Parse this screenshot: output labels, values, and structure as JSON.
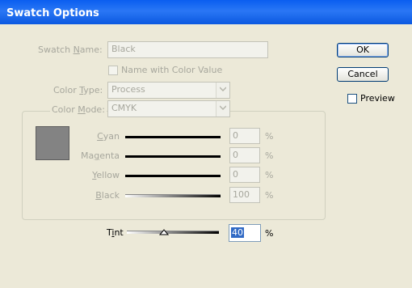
{
  "window": {
    "title": "Swatch Options"
  },
  "swatch_name": {
    "label_pre": "Swatch ",
    "label_u": "N",
    "label_post": "ame:",
    "value": "Black"
  },
  "name_with_color_value": {
    "label": "Name with Color Value",
    "checked": false
  },
  "color_type": {
    "label_pre": "Color ",
    "label_u": "T",
    "label_post": "ype:",
    "value": "Process"
  },
  "color_mode": {
    "label_pre": "Color ",
    "label_u": "M",
    "label_post": "ode:",
    "value": "CMYK"
  },
  "sliders": [
    {
      "pre": "",
      "u": "C",
      "post": "yan",
      "value": "0",
      "unit": "%"
    },
    {
      "pre": "Ma",
      "u": "g",
      "post": "enta",
      "value": "0",
      "unit": "%"
    },
    {
      "pre": "",
      "u": "Y",
      "post": "ellow",
      "value": "0",
      "unit": "%"
    },
    {
      "pre": "",
      "u": "B",
      "post": "lack",
      "value": "100",
      "unit": "%"
    }
  ],
  "tint": {
    "pre": "T",
    "u": "i",
    "post": "nt",
    "value": "40",
    "unit": "%",
    "level": 0.4
  },
  "buttons": {
    "ok": "OK",
    "cancel": "Cancel"
  },
  "preview": {
    "label": "Preview",
    "checked": false
  },
  "colors": {
    "title_bar": "#0a5ef0",
    "swatch": "#838383",
    "dialog_bg": "#ece9d8"
  }
}
